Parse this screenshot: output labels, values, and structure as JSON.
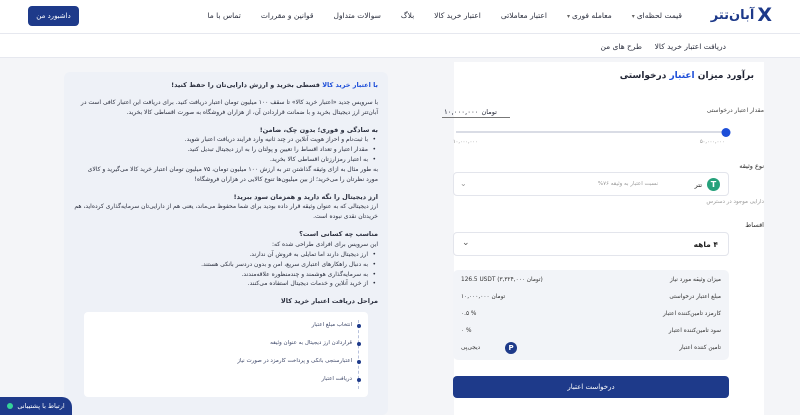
{
  "header": {
    "logo_mark": "X",
    "logo_text": "آبان‌تتر",
    "nav": [
      "قیمت لحظه‌ای",
      "معامله فوری",
      "اعتبار معاملاتی",
      "اعتبار خرید کالا",
      "بلاگ",
      "سوالات متداول",
      "قوانین و مقررات",
      "تماس با ما"
    ],
    "dashboard_btn": "داشبورد من"
  },
  "tabs": [
    "دریافت اعتبار خرید کالا",
    "طرح های من"
  ],
  "calc": {
    "title_pre": "برآورد میزان",
    "title_hl": "اعتبار",
    "title_post": "درخواستی",
    "amount_label": "مقدار اعتبار درخواستی",
    "amount_value": "۱۰,۰۰۰,۰۰۰",
    "amount_unit": "تومان",
    "slider_fraction": 0,
    "slider_min": "۱۰,۰۰۰,۰۰۰",
    "slider_max": "۵۰,۰۰۰,۰۰۰",
    "collateral_label": "نوع وثیقه",
    "collateral_name": "تتر",
    "collateral_ratio": "نسبت اعتبار به وثیقه ۷۶%",
    "collateral_balance": "دارایی موجود در دسترس",
    "installments_label": "اقساط",
    "installments_value": "۴ ماهه",
    "summary": [
      {
        "k": "میزان وثیقه مورد نیاز",
        "v": "126.5 USDT (۳,۳۲۴,۰۰۰ تومان)"
      },
      {
        "k": "مبلغ اعتبار درخواستی",
        "v": "۱۰,۰۰۰,۰۰۰ تومان"
      },
      {
        "k": "کارمزد تامین‌کننده اعتبار",
        "v": "۰.۵ %"
      },
      {
        "k": "سود تامین‌کننده اعتبار",
        "v": "۰ %"
      },
      {
        "k": "تامین کننده اعتبار",
        "v": "دیجی‌پی"
      }
    ],
    "submit": "درخواست اعتبار"
  },
  "info": {
    "intro_blue": "با اعتبار خرید کالا",
    "intro_rest": "قسطی بخرید و ارزش دارایی‌تان را حفظ کنید!",
    "p1": "با سرویس جدید «اعتبار خرید کالا» تا سقف ۱۰۰ میلیون تومان اعتبار دریافت کنید. برای دریافت این اعتبار کافی است در آبان‌تتر ارز دیجیتال بخرید و با ضمانت قراردادن آن، از هزاران فروشگاه به صورت اقساطی کالا بخرید.",
    "h2": "به سادگی و فوری؛ بدون چک، ضامن!",
    "b2": [
      "با ثبت‌نام و احراز هویت آنلاین در چند ثانیه وارد فرایند دریافت اعتبار شوید.",
      "مقدار اعتبار و تعداد اقساط را تعیین و پولتان را به ارز دیجیتال تبدیل کنید.",
      "به اعتبار رمزارزتان اقساطی کالا بخرید."
    ],
    "p3": "به طور مثال به ازای وثیقه گذاشتن تتر به ارزش ۱۰۰ میلیون تومان، ۷۵ میلیون تومان اعتبار خرید کالا می‌گیرید و کالای مورد نظرتان را می‌خرید؛ از بین میلیون‌ها تنوع کالایی در هزاران فروشگاه!",
    "h4": "ارز دیجیتال را نگه دارید و همزمان سود ببرید!",
    "p4": "ارز دیجیتالی که به عنوان وثیقه قرار داده بودید برای شما محفوظ می‌ماند، یعنی هم از دارایی‌تان سرمایه‌گذاری کرده‌اید، هم خریدتان نقدی نبوده است.",
    "h5": "مناسب چه کسانی است؟",
    "p5": "این سرویس برای افرادی طراحی شده که:",
    "b5": [
      "ارز دیجیتال دارند اما تمایلی به فروش آن ندارند.",
      "به دنبال راهکارهای اعتباری سریع، امن و بدون دردسر بانکی هستند.",
      "به سرمایه‌گذاری هوشمند و چندمنظوره علاقه‌مندند.",
      "از خرید آنلاین و خدمات دیجیتال استفاده می‌کنند."
    ],
    "h6": "مراحل دریافت اعتبار خرید کالا",
    "steps": [
      "انتخاب مبلغ اعتبار",
      "قراردادن ارز دیجیتال به عنوان وثیقه",
      "اعتبارسنجی بانکی و پرداخت کارمزد در صورت نیاز",
      "دریافت اعتبار"
    ]
  },
  "support": "ارتباط با پشتیبانی"
}
